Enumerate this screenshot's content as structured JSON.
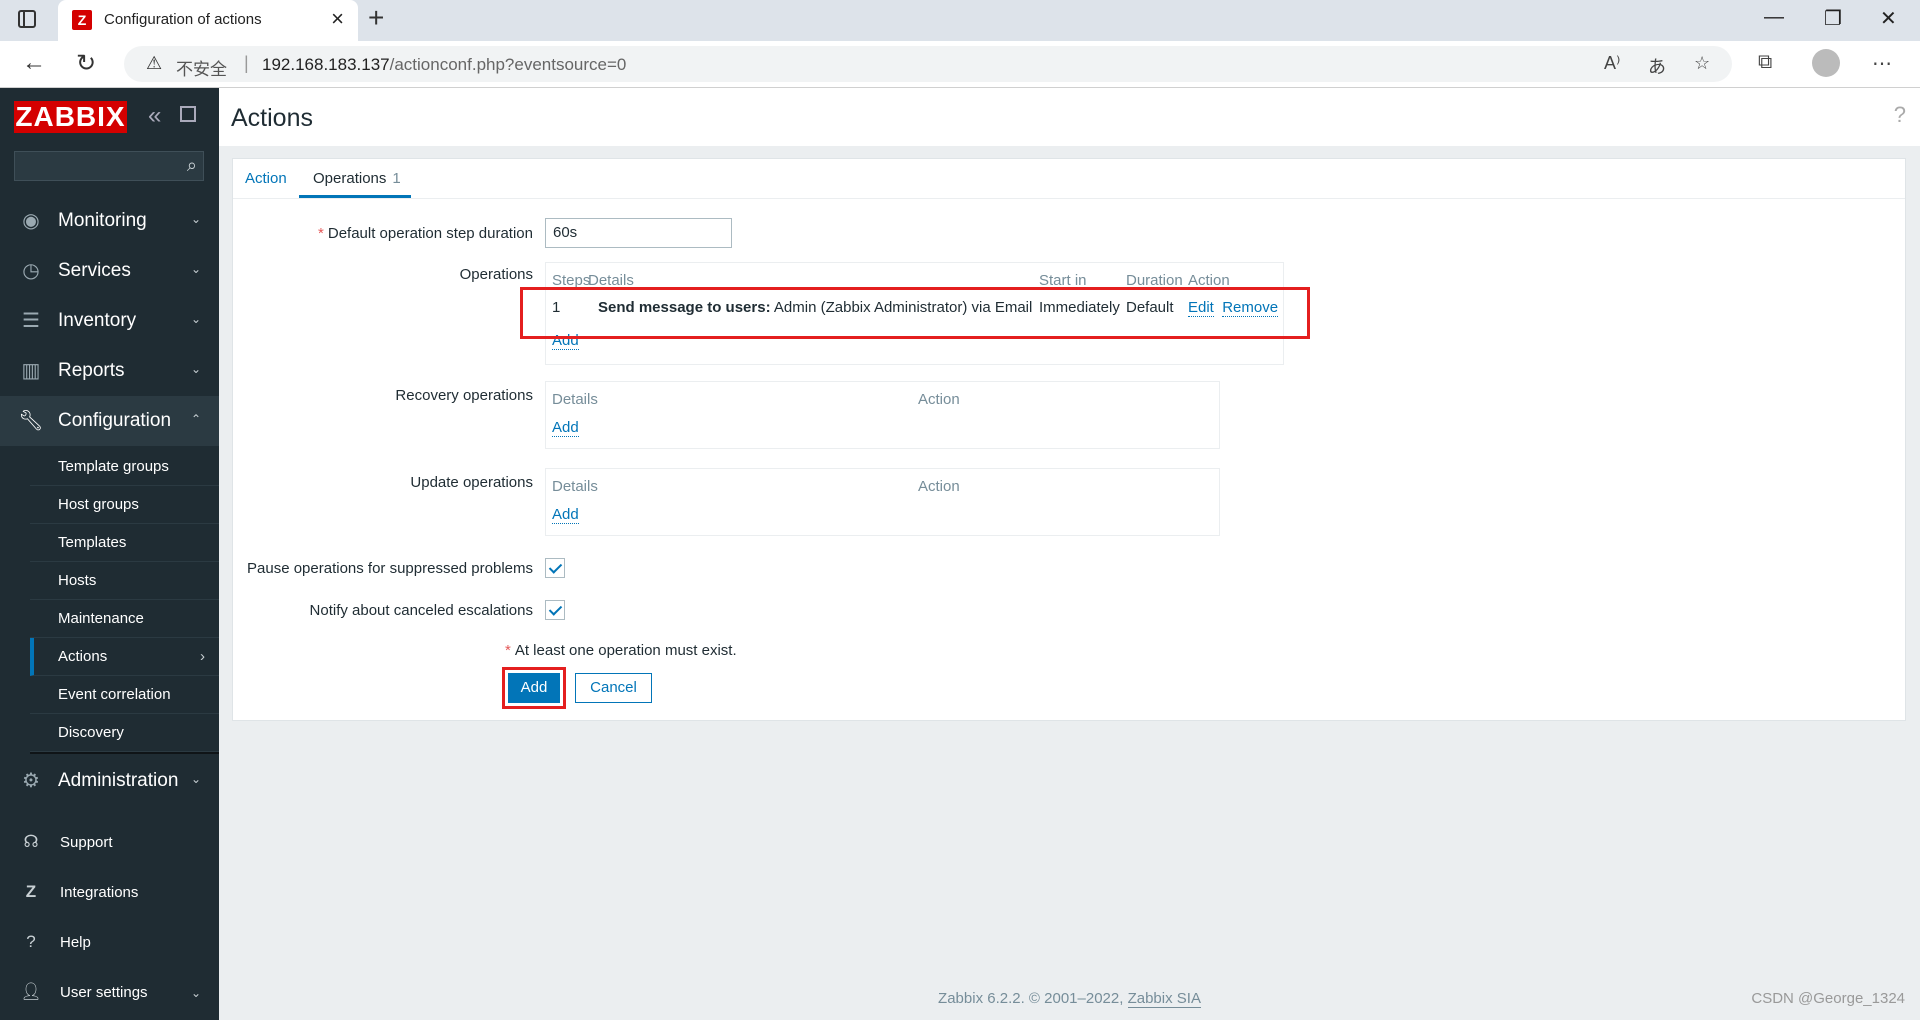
{
  "browser": {
    "tab_title": "Configuration of actions",
    "favicon_letter": "Z",
    "insecure_label": "不安全",
    "url_host": "192.168.183.137",
    "url_path": "/actionconf.php?eventsource=0"
  },
  "sidebar": {
    "logo": "ZABBIX",
    "menu": [
      {
        "label": "Monitoring",
        "icon": "eye-icon"
      },
      {
        "label": "Services",
        "icon": "clock-icon"
      },
      {
        "label": "Inventory",
        "icon": "list-icon"
      },
      {
        "label": "Reports",
        "icon": "bar-chart-icon"
      },
      {
        "label": "Configuration",
        "icon": "wrench-icon"
      },
      {
        "label": "Administration",
        "icon": "gear-icon"
      }
    ],
    "submenu": [
      "Template groups",
      "Host groups",
      "Templates",
      "Hosts",
      "Maintenance",
      "Actions",
      "Event correlation",
      "Discovery"
    ],
    "bottom": [
      {
        "label": "Support",
        "icon": "headset-icon"
      },
      {
        "label": "Integrations",
        "icon": "zabbix-z-icon"
      },
      {
        "label": "Help",
        "icon": "question-icon"
      },
      {
        "label": "User settings",
        "icon": "user-icon"
      }
    ]
  },
  "page": {
    "title": "Actions",
    "tabs": [
      {
        "label": "Action"
      },
      {
        "label": "Operations",
        "badge": "1"
      }
    ]
  },
  "form": {
    "step_duration_label": "Default operation step duration",
    "step_duration_value": "60s",
    "operations_label": "Operations",
    "operations_headers": [
      "Steps",
      "Details",
      "Start in",
      "Duration",
      "Action"
    ],
    "operation_row": {
      "step": "1",
      "details_bold": "Send message to users:",
      "details_rest": " Admin (Zabbix Administrator) via Email",
      "start_in": "Immediately",
      "duration": "Default",
      "edit": "Edit",
      "remove": "Remove"
    },
    "add_link": "Add",
    "recovery_label": "Recovery operations",
    "update_label": "Update operations",
    "sub_headers": [
      "Details",
      "Action"
    ],
    "pause_label": "Pause operations for suppressed problems",
    "notify_label": "Notify about canceled escalations",
    "warning": "At least one operation must exist.",
    "add_button": "Add",
    "cancel_button": "Cancel"
  },
  "footer": {
    "text": "Zabbix 6.2.2. © 2001–2022, ",
    "link": "Zabbix SIA"
  },
  "watermark": "CSDN @George_1324",
  "colors": {
    "brand": "#d40000",
    "accent": "#0275b8",
    "sidebar": "#1f2c33",
    "highlight": "#e41f1f"
  }
}
